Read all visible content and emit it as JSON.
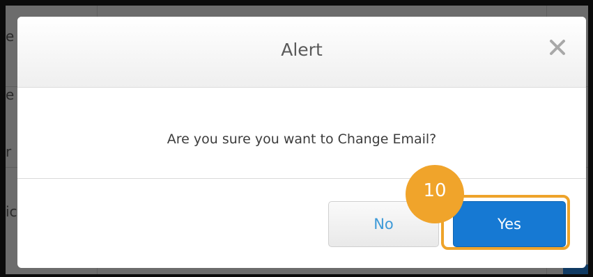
{
  "dialog": {
    "title": "Alert",
    "message": "Are you sure you want to Change Email?",
    "no_label": "No",
    "yes_label": "Yes",
    "close_icon": "close-icon"
  },
  "callout": {
    "step_number": "10",
    "color": "#eea32a"
  },
  "colors": {
    "primary_button": "#1679d3",
    "secondary_text": "#3d9ad8"
  },
  "background_fragments": [
    "e",
    "e",
    "r",
    "ic"
  ]
}
